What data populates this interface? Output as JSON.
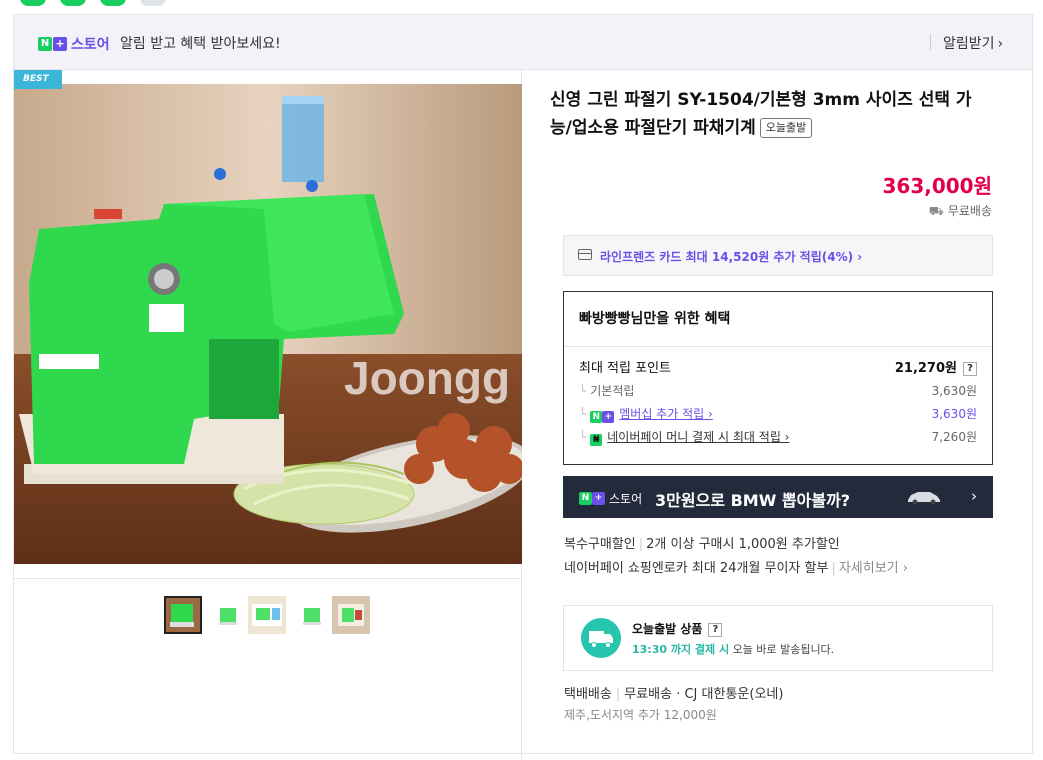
{
  "banner": {
    "store_word": "스토어",
    "message": "알림 받고 혜택 받아보세요!",
    "alarm_label": "알림받기"
  },
  "gallery": {
    "best_badge": "BEST",
    "watermark": "Joongg"
  },
  "product": {
    "title": "신영 그린 파절기 SY-1504/기본형 3mm 사이즈 선택 가능/업소용 파절단기 파채기계",
    "today_badge": "오늘출발",
    "price": "363,000원",
    "shipping": "무료배송"
  },
  "card_promo": {
    "text": "라인프렌즈 카드 최대 14,520원 추가 적립(4%) ›"
  },
  "benefit": {
    "header": "빠방빵빵님만을 위한 혜택",
    "rows": [
      {
        "label": "최대 적립 포인트",
        "value": "21,270원",
        "q": "?"
      },
      {
        "label": "기본적립",
        "value": "3,630원"
      },
      {
        "label": "멤버십 추가 적립 ›",
        "value": "3,630원"
      },
      {
        "label": "네이버페이 머니 결제 시 최대 적립 ›",
        "value": "7,260원"
      }
    ]
  },
  "bmw_banner": {
    "store_word": "스토어",
    "text": "3만원으로 BMW 뽑아볼까?",
    "chevron": "›"
  },
  "discounts": {
    "multi_label": "복수구매할인",
    "multi_text": "2개 이상 구매시 1,000원 추가할인",
    "install_text": "네이버페이 쇼핑엔로카 최대 24개월 무이자 할부",
    "install_more": "자세히보기 ›"
  },
  "today_box": {
    "title": "오늘출발 상품",
    "q": "?",
    "time": "13:30 까지 결제 시",
    "rest": " 오늘 바로 발송됩니다."
  },
  "delivery": {
    "method": "택배배송",
    "fee": "무료배송",
    "carrier": "· CJ 대한통운(오네)",
    "jeju": "제주,도서지역 추가 12,000원"
  },
  "colors": {
    "accent": "#6a4fe8",
    "naver_green": "#19ce60",
    "price_red": "#e0004a",
    "teal": "#27c4ae"
  }
}
